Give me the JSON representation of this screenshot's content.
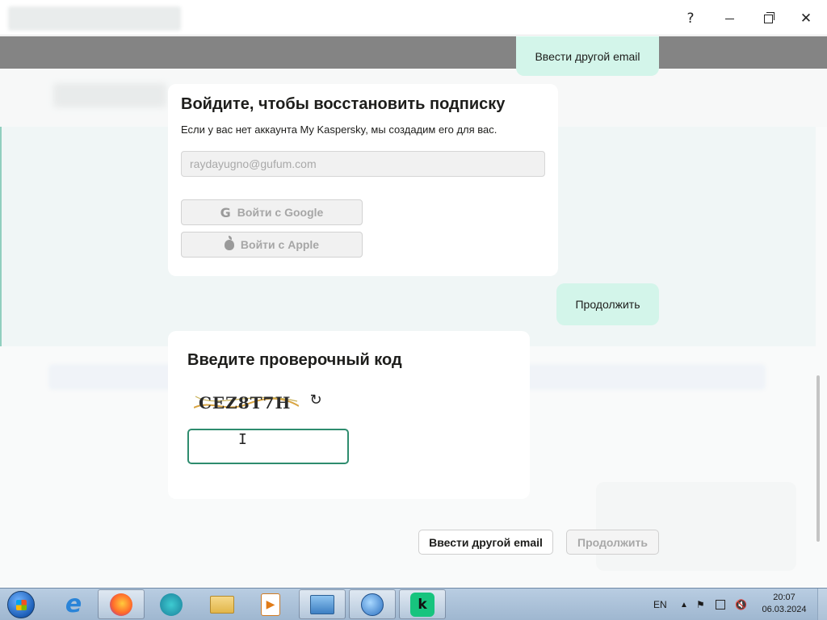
{
  "window": {
    "help_label": "?",
    "close_label": "✕"
  },
  "top_email_button": {
    "label": "Ввести другой email"
  },
  "login": {
    "title": "Войдите, чтобы восстановить подписку",
    "subtitle": "Если у вас нет аккаунта My Kaspersky, мы создадим его для вас.",
    "email_value": "raydayugno@gufum.com",
    "google_label": "Войти с Google",
    "apple_label": "Войти с Apple",
    "google_icon": "google-icon",
    "apple_icon": "apple-icon"
  },
  "mid_continue_button": {
    "label": "Продолжить"
  },
  "verification": {
    "title": "Введите проверочный код",
    "captcha_text": "CEZ8T7H",
    "refresh_icon": "refresh-icon",
    "code_value": ""
  },
  "footer": {
    "email_label": "Ввести другой email",
    "continue_label": "Продолжить"
  },
  "taskbar": {
    "apps": [
      {
        "name": "internet-explorer-icon"
      },
      {
        "name": "firefox-icon"
      },
      {
        "name": "media-app-icon"
      },
      {
        "name": "file-explorer-icon"
      },
      {
        "name": "media-player-icon"
      },
      {
        "name": "remote-desktop-icon"
      },
      {
        "name": "network-globe-icon"
      },
      {
        "name": "kaspersky-icon",
        "glyph": "k"
      }
    ],
    "tray": {
      "language": "EN",
      "overflow_arrow": "▲"
    },
    "clock": {
      "time": "20:07",
      "date": "06.03.2024"
    }
  },
  "colors": {
    "accent_mint": "#d3f5ea",
    "accent_green": "#2e8c6e",
    "kaspersky_green": "#17c47e"
  }
}
